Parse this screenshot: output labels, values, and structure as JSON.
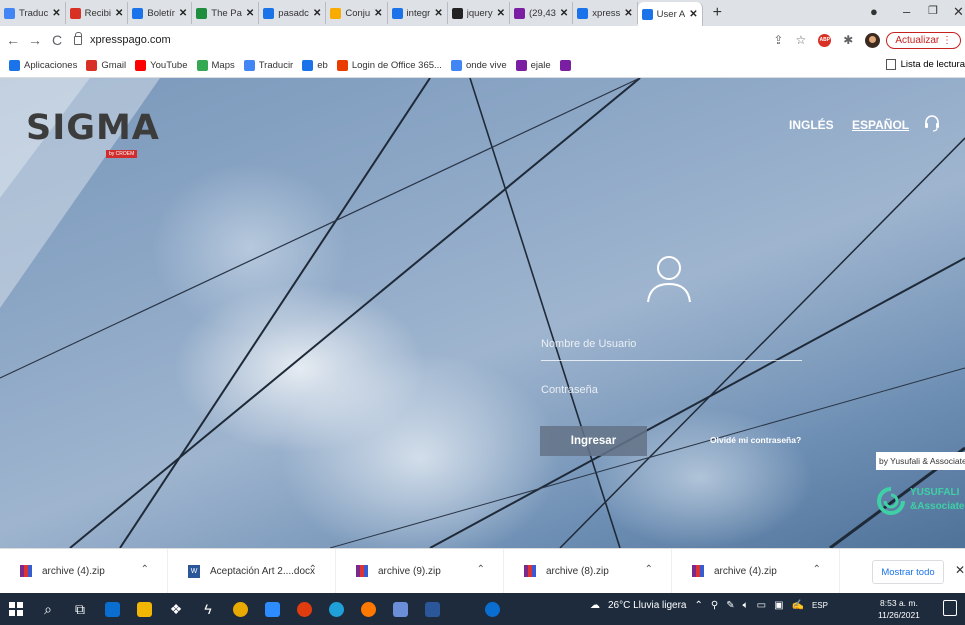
{
  "browser": {
    "tabs": [
      {
        "label": "Traduc",
        "icon": "translate-icon",
        "color": "#4285f4"
      },
      {
        "label": "Recibi",
        "icon": "gmail-icon",
        "color": "#d93025"
      },
      {
        "label": "Boletír",
        "icon": "calendar-icon",
        "color": "#1a73e8"
      },
      {
        "label": "The Pa",
        "icon": "chrome-icon",
        "color": "#1e8e3e"
      },
      {
        "label": "pasadc",
        "icon": "search-icon",
        "color": "#1a73e8"
      },
      {
        "label": "Conju",
        "icon": "conjugation-icon",
        "color": "#f9ab00"
      },
      {
        "label": "integr",
        "icon": "search-icon",
        "color": "#1a73e8"
      },
      {
        "label": "jquery",
        "icon": "stackoverflow-icon",
        "color": "#222"
      },
      {
        "label": "(29,43",
        "icon": "mail-icon",
        "color": "#7b1fa2"
      },
      {
        "label": "xpress",
        "icon": "search-icon",
        "color": "#1a73e8"
      },
      {
        "label": "User A",
        "icon": "user-app-icon",
        "color": "#1a73e8"
      }
    ],
    "new_tab": "+",
    "window_controls": {
      "minimize": "–",
      "restore": "❐",
      "close": "✕"
    },
    "address": "xpresspago.com",
    "update_label": "Actualizar",
    "bookmarks": [
      {
        "label": "Aplicaciones",
        "icon": "apps-grid-icon",
        "color": "#1a73e8"
      },
      {
        "label": "Gmail",
        "icon": "gmail-icon",
        "color": "#d93025"
      },
      {
        "label": "YouTube",
        "icon": "youtube-icon",
        "color": "#ff0000"
      },
      {
        "label": "Maps",
        "icon": "maps-pin-icon",
        "color": "#34a853"
      },
      {
        "label": "Traducir",
        "icon": "translate-icon",
        "color": "#4285f4"
      },
      {
        "label": "eb",
        "icon": "calendar-icon",
        "color": "#1a73e8"
      },
      {
        "label": "Login de Office 365...",
        "icon": "office-icon",
        "color": "#eb3c00"
      },
      {
        "label": "onde vive",
        "icon": "translate-icon",
        "color": "#4285f4"
      },
      {
        "label": "ejale",
        "icon": "mail-icon",
        "color": "#7b1fa2"
      },
      {
        "label": "",
        "icon": "mail-icon",
        "color": "#7b1fa2"
      }
    ],
    "reading_list": "Lista de lectura"
  },
  "page": {
    "logo": "SIGMA",
    "logo_sub": "by CROEM",
    "lang_en": "INGLÉS",
    "lang_es": "ESPAÑOL",
    "username_placeholder": "Nombre de Usuario",
    "password_placeholder": "Contraseña",
    "login_button": "Ingresar",
    "forgot_link": "Olvidé mi contraseña?",
    "partner_name": "YUSUFALI",
    "partner_sub": "&Associate",
    "partner_caption": "by Yusufali & Associates"
  },
  "downloads": {
    "items": [
      {
        "name": "archive (4).zip",
        "type": "zip"
      },
      {
        "name": "Aceptación Art 2....docx",
        "type": "docx"
      },
      {
        "name": "archive (9).zip",
        "type": "zip"
      },
      {
        "name": "archive (8).zip",
        "type": "zip"
      },
      {
        "name": "archive (4).zip",
        "type": "zip"
      }
    ],
    "show_all": "Mostrar todo",
    "close": "✕"
  },
  "taskbar": {
    "weather": "26°C  Lluvia ligera",
    "language": "ESP",
    "time": "8:53 a. m.",
    "date": "11/26/2021"
  }
}
